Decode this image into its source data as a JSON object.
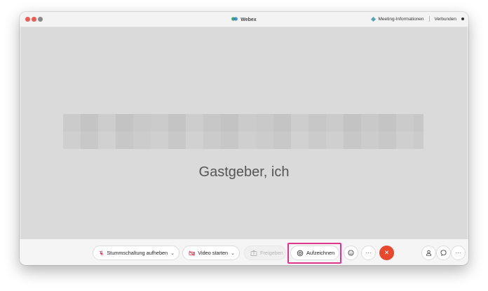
{
  "app": {
    "title": "Webex",
    "meeting_info_label": "Meeting-Informationen",
    "connection_status": "Verbunden"
  },
  "stage": {
    "participant_name": "Gastgeber, ich"
  },
  "controls": {
    "mute_label": "Stummschaltung aufheben",
    "video_label": "Video starten",
    "share_label": "Freigeben",
    "record_label": "Aufzeichnen",
    "more_glyph": "···",
    "end_glyph": "✕"
  },
  "colors": {
    "end_call": "#e9472e",
    "highlight": "#e0358c",
    "mute_icon": "#d9334f",
    "video_icon": "#d9334f"
  }
}
